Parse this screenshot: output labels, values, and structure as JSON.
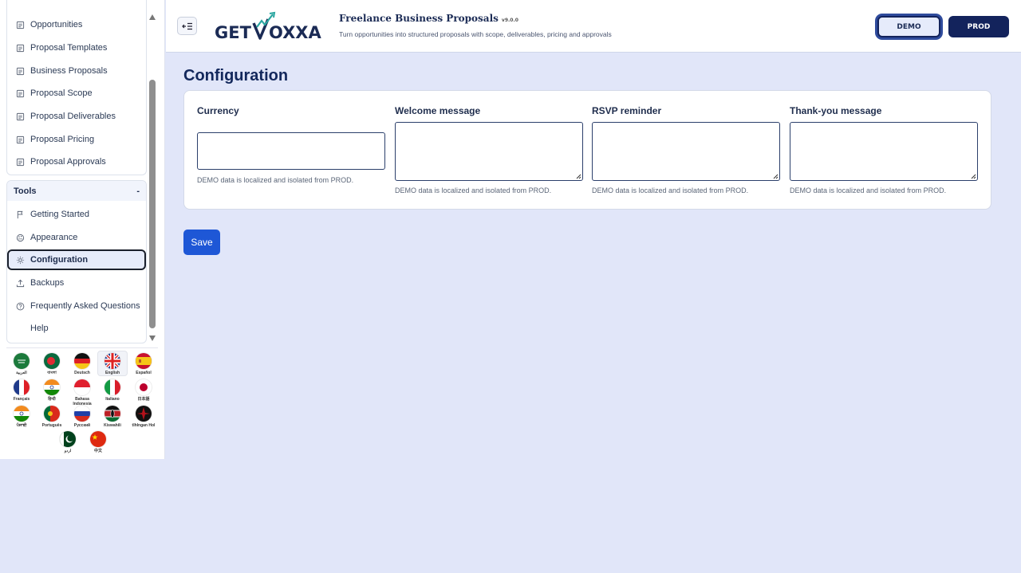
{
  "sidebar": {
    "items": [
      {
        "label": "Opportunities",
        "icon": "document-icon"
      },
      {
        "label": "Proposal Templates",
        "icon": "document-icon"
      },
      {
        "label": "Business Proposals",
        "icon": "document-icon"
      },
      {
        "label": "Proposal Scope",
        "icon": "document-icon"
      },
      {
        "label": "Proposal Deliverables",
        "icon": "document-icon"
      },
      {
        "label": "Proposal Pricing",
        "icon": "document-icon"
      },
      {
        "label": "Proposal Approvals",
        "icon": "document-icon"
      }
    ],
    "tools": {
      "title": "Tools",
      "toggle": "-",
      "items": [
        {
          "label": "Getting Started",
          "icon": "flag-icon"
        },
        {
          "label": "Appearance",
          "icon": "palette-icon"
        },
        {
          "label": "Configuration",
          "icon": "gear-icon",
          "active": true
        },
        {
          "label": "Backups",
          "icon": "upload-icon"
        },
        {
          "label": "Frequently Asked Questions",
          "icon": "help-circle-icon"
        },
        {
          "label": "Help",
          "icon": ""
        }
      ]
    },
    "languages": [
      {
        "label": "العربية",
        "flag": "saudi-arabia"
      },
      {
        "label": "বাংলা",
        "flag": "bangladesh"
      },
      {
        "label": "Deutsch",
        "flag": "germany"
      },
      {
        "label": "English",
        "flag": "uk",
        "selected": true
      },
      {
        "label": "Español",
        "flag": "spain"
      },
      {
        "label": "Français",
        "flag": "france"
      },
      {
        "label": "हिन्दी",
        "flag": "india"
      },
      {
        "label": "Bahasa Indonesia",
        "flag": "indonesia"
      },
      {
        "label": "Italiano",
        "flag": "italy"
      },
      {
        "label": "日本語",
        "flag": "japan"
      },
      {
        "label": "ਪੰਜਾਬੀ",
        "flag": "india"
      },
      {
        "label": "Português",
        "flag": "portugal"
      },
      {
        "label": "Русский",
        "flag": "russia"
      },
      {
        "label": "Kiswahili",
        "flag": "kenya"
      },
      {
        "label": "tlhIngan Hol",
        "flag": "klingon"
      },
      {
        "label": "اردو",
        "flag": "pakistan"
      },
      {
        "label": "中文",
        "flag": "china"
      }
    ]
  },
  "header": {
    "logo_text": "GETVOXXA",
    "app_title": "Freelance Business Proposals",
    "version": "v9.0.0",
    "tagline": "Turn opportunities into structured proposals with scope, deliverables, pricing and approvals",
    "demo_label": "DEMO",
    "prod_label": "PROD"
  },
  "main": {
    "title": "Configuration",
    "fields": [
      {
        "label": "Currency",
        "value": "",
        "help": "DEMO data is localized and isolated from PROD."
      },
      {
        "label": "Welcome message",
        "value": "",
        "help": "DEMO data is localized and isolated from PROD."
      },
      {
        "label": "RSVP reminder",
        "value": "",
        "help": "DEMO data is localized and isolated from PROD."
      },
      {
        "label": "Thank-you message",
        "value": "",
        "help": "DEMO data is localized and isolated from PROD."
      }
    ],
    "save_label": "Save"
  },
  "colors": {
    "background": "#e1e6f9",
    "accent": "#1e57d6",
    "navy": "#13235c"
  }
}
